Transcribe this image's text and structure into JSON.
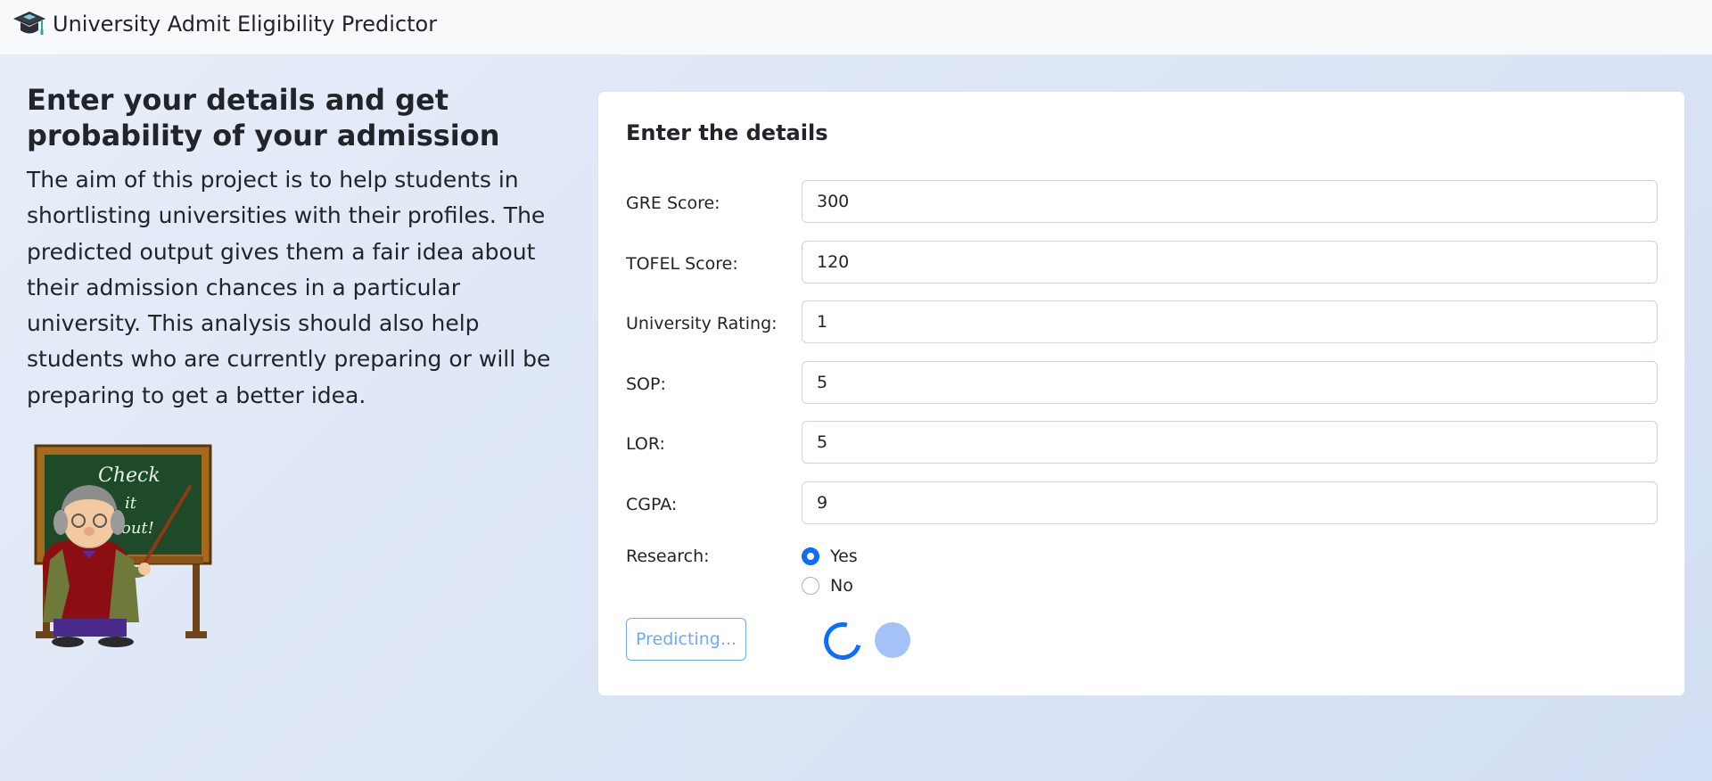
{
  "navbar": {
    "brand": "University Admit Eligibility Predictor",
    "icon": "graduation-cap-icon"
  },
  "intro": {
    "heading": "Enter your details and get probability of your admission",
    "description": "The aim of this project is to help students in shortlisting universities with their profiles. The predicted output gives them a fair idea about their admission chances in a particular university. This analysis should also help students who are currently preparing or will be preparing to get a better idea.",
    "illustration": {
      "board_text": [
        "Check",
        "it",
        "out!"
      ]
    }
  },
  "form": {
    "title": "Enter the details",
    "fields": [
      {
        "label": "GRE Score:",
        "value": "300"
      },
      {
        "label": "TOFEL Score:",
        "value": "120"
      },
      {
        "label": "University Rating:",
        "value": "1"
      },
      {
        "label": "SOP:",
        "value": "5"
      },
      {
        "label": "LOR:",
        "value": "5"
      },
      {
        "label": "CGPA:",
        "value": "9"
      }
    ],
    "research": {
      "label": "Research:",
      "options": [
        {
          "label": "Yes",
          "checked": true
        },
        {
          "label": "No",
          "checked": false
        }
      ]
    },
    "submit_label": "Predicting..."
  },
  "colors": {
    "primary": "#0d6efd",
    "primary_light": "#6ea8fe",
    "spinner_grow": "#a3c2f8"
  }
}
